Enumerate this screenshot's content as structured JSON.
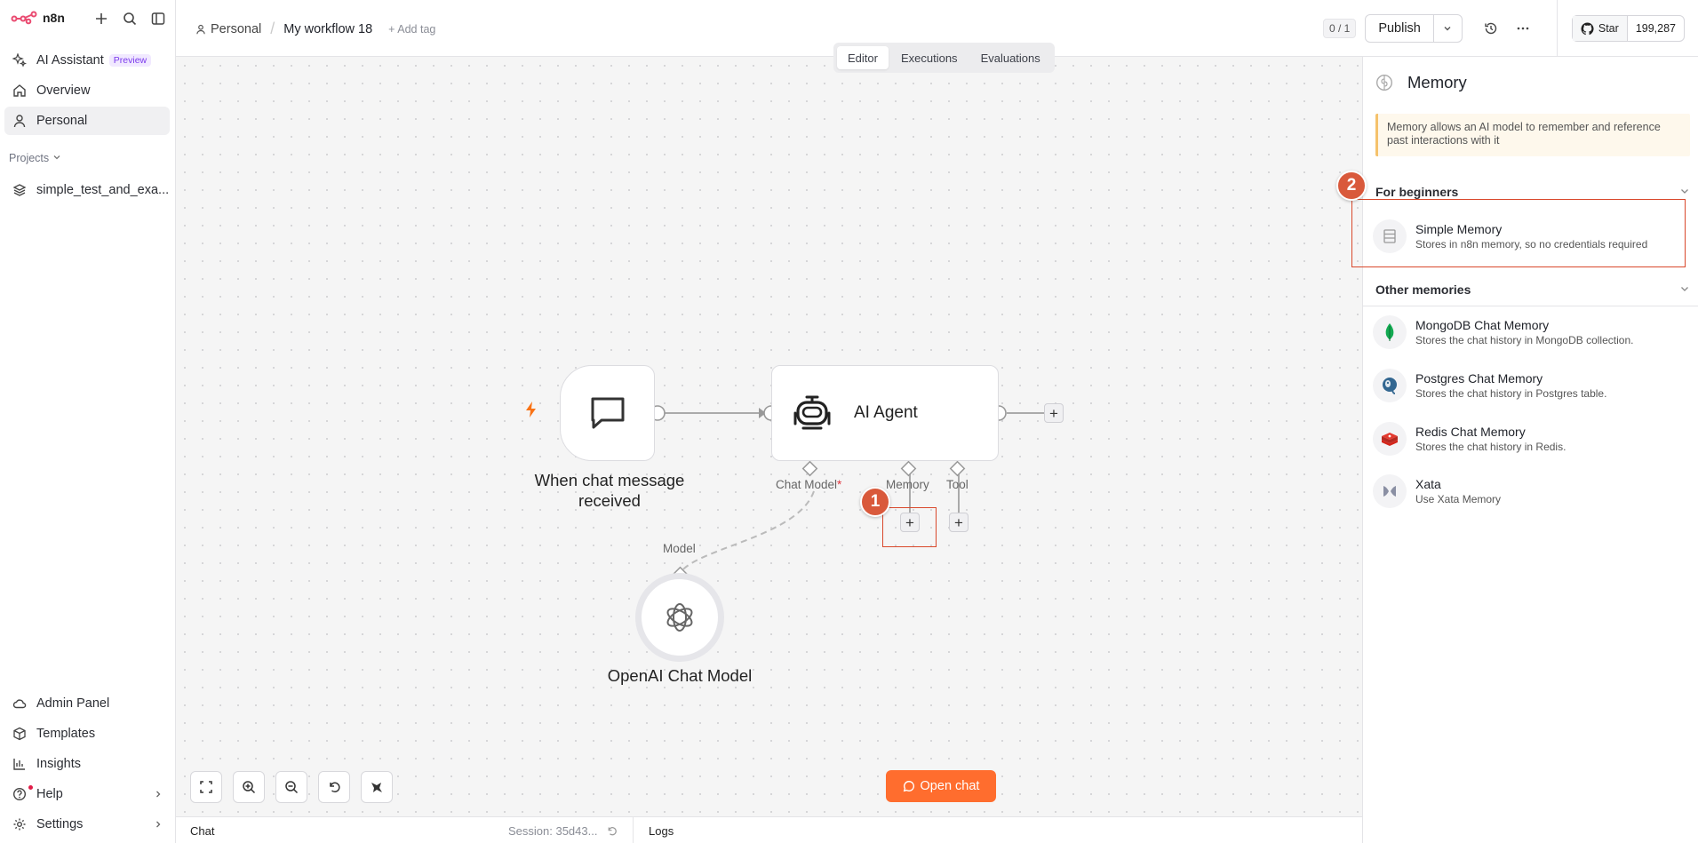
{
  "app": {
    "logo": "n8n"
  },
  "sidebar": {
    "items": [
      {
        "label": "AI Assistant",
        "badge": "Preview"
      },
      {
        "label": "Overview"
      },
      {
        "label": "Personal"
      }
    ],
    "projects_label": "Projects",
    "project": "simple_test_and_exa...",
    "bottom_items": [
      {
        "label": "Admin Panel"
      },
      {
        "label": "Templates"
      },
      {
        "label": "Insights"
      },
      {
        "label": "Help"
      },
      {
        "label": "Settings"
      }
    ]
  },
  "header": {
    "breadcrumb_personal": "Personal",
    "workflow_name": "My workflow 18",
    "add_tag": "+ Add tag",
    "counter": "0 / 1",
    "publish": "Publish",
    "github_star": "Star",
    "github_count": "199,287"
  },
  "tabs": [
    "Editor",
    "Executions",
    "Evaluations"
  ],
  "canvas": {
    "trigger_label_1": "When chat message",
    "trigger_label_2": "received",
    "agent_title": "AI Agent",
    "port_chat_model": "Chat Model",
    "port_required_mark": "*",
    "port_memory": "Memory",
    "port_tool": "Tool",
    "port_model": "Model",
    "openai_label": "OpenAI Chat Model",
    "plus": "+",
    "step1": "1",
    "step2": "2",
    "open_chat": "Open chat"
  },
  "bottom": {
    "chat": "Chat",
    "session": "Session: 35d43...",
    "logs": "Logs"
  },
  "panel": {
    "title": "Memory",
    "notice": "Memory allows an AI model to remember and reference past interactions with it",
    "section_beginners": "For beginners",
    "section_other": "Other memories",
    "beginner_items": [
      {
        "name": "Simple Memory",
        "desc": "Stores in n8n memory, so no credentials required"
      }
    ],
    "other_items": [
      {
        "name": "MongoDB Chat Memory",
        "desc": "Stores the chat history in MongoDB collection."
      },
      {
        "name": "Postgres Chat Memory",
        "desc": "Stores the chat history in Postgres table."
      },
      {
        "name": "Redis Chat Memory",
        "desc": "Stores the chat history in Redis."
      },
      {
        "name": "Xata",
        "desc": "Use Xata Memory"
      }
    ]
  },
  "colors": {
    "accent": "#ff6d2e",
    "highlight": "#d9482b",
    "badge": "#d9593b",
    "preview": "#7c3aed"
  }
}
